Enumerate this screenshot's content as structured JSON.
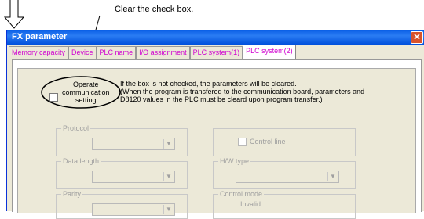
{
  "annotation": {
    "instruction": "Clear the check box."
  },
  "window": {
    "title": "FX parameter"
  },
  "tabs": [
    {
      "label": "Memory capacity"
    },
    {
      "label": "Device"
    },
    {
      "label": "PLC name"
    },
    {
      "label": "I/O assignment"
    },
    {
      "label": "PLC system(1)"
    },
    {
      "label": "PLC system(2)"
    }
  ],
  "operate": {
    "label_line1": "Operate",
    "label_line2": "communication",
    "label_line3": "setting",
    "checked": false
  },
  "info": {
    "line1": "If the box is not checked, the parameters will be cleared.",
    "line2": "(When the program is transfered to the communication board, parameters and",
    "line3": "D8120 values in the PLC must be cleard upon program transfer.)"
  },
  "groups": {
    "protocol": "Protocol",
    "control_line": "Control line",
    "data_length": "Data length",
    "hw_type": "H/W type",
    "parity": "Parity",
    "control_mode": "Control mode",
    "control_mode_value": "Invalid"
  }
}
